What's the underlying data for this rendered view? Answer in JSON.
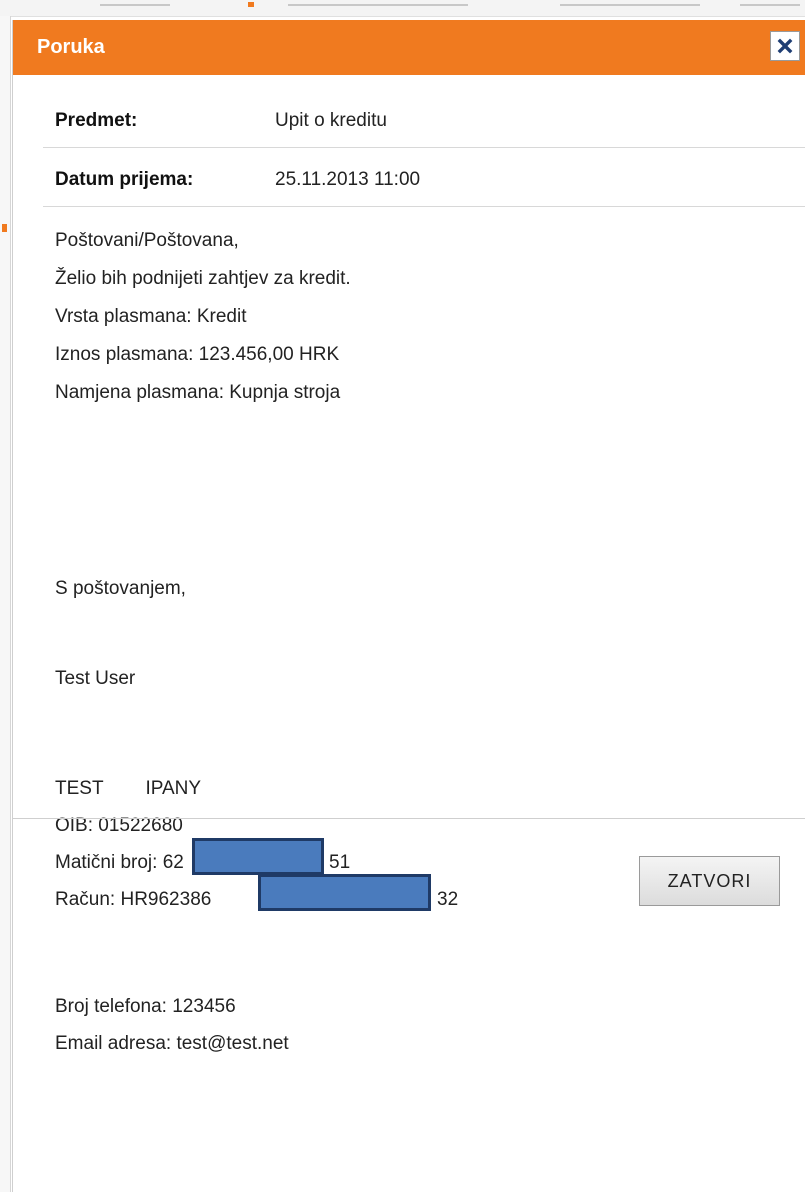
{
  "dialog": {
    "title": "Poruka",
    "close_icon": "close-x-icon"
  },
  "meta": {
    "subject_label": "Predmet:",
    "subject_value": "Upit o kreditu",
    "date_label": "Datum prijema:",
    "date_value": "25.11.2013 11:00"
  },
  "message": {
    "greeting": "Poštovani/Poštovana,",
    "line1": "Želio bih podnijeti zahtjev za kredit.",
    "line2": "Vrsta plasmana: Kredit",
    "line3": "Iznos plasmana: 123.456,00 HRK",
    "line4": "Namjena plasmana: Kupnja stroja",
    "closing": "S poštovanjem,",
    "sender": "Test User",
    "company": "TEST        IPANY",
    "oib": "OIB: 01522680",
    "maticni_broj_start": "Matični broj: 62",
    "maticni_broj_end": "51",
    "racun_start": "Račun: HR962386",
    "racun_end": "32",
    "phone": "Broj telefona: 123456",
    "email": "Email adresa: test@test.net"
  },
  "colors": {
    "header": "#f07a1f",
    "redaction": "#4a7bbd"
  },
  "footer": {
    "close_button_label": "ZATVORI"
  }
}
